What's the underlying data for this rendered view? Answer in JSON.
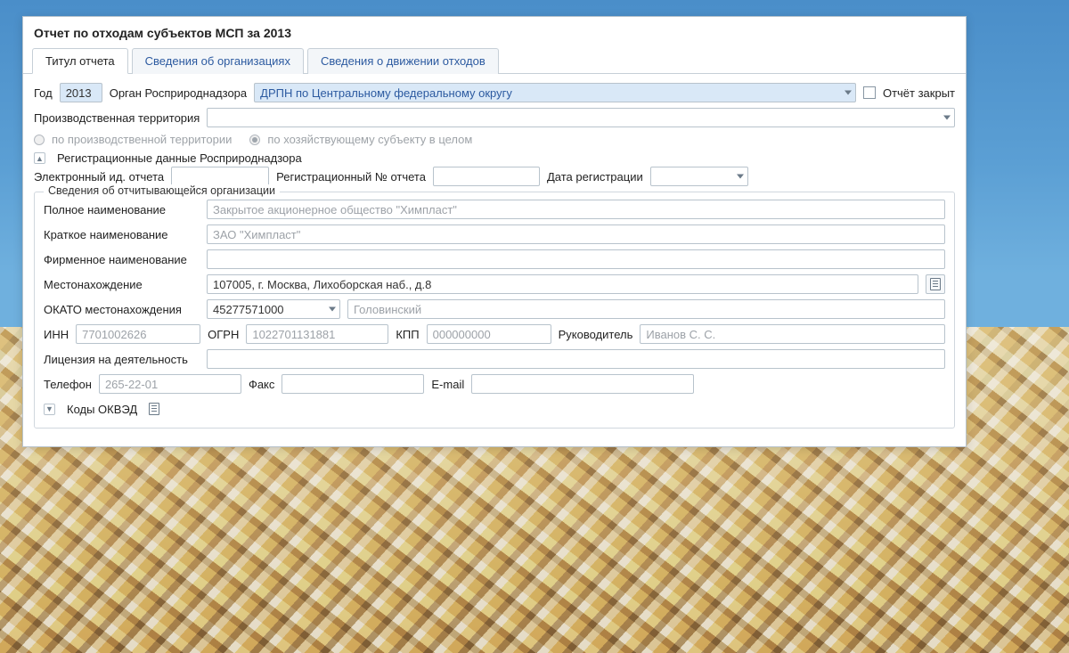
{
  "title": "Отчет по отходам субъектов МСП за 2013",
  "tabs": {
    "t0": "Титул отчета",
    "t1": "Сведения об организациях",
    "t2": "Сведения о движении отходов"
  },
  "top": {
    "yearLabel": "Год",
    "year": "2013",
    "agencyLabel": "Орган Росприроднадзора",
    "agency": "ДРПН по Центральному федеральному округу",
    "closedLabel": "Отчёт закрыт",
    "territoryLabel": "Производственная территория",
    "radio1": "по производственной территории",
    "radio2": "по хозяйствующему субъекту в целом"
  },
  "reg": {
    "header": "Регистрационные данные Росприроднадзора",
    "toggle": "▲",
    "eidLabel": "Электронный ид. отчета",
    "regNoLabel": "Регистрационный № отчета",
    "regDateLabel": "Дата регистрации"
  },
  "org": {
    "header": "Сведения об отчитывающейся организации",
    "fullLabel": "Полное наименование",
    "full": "Закрытое акционерное общество \"Химпласт\"",
    "shortLabel": "Краткое наименование",
    "short": "ЗАО \"Химпласт\"",
    "brandLabel": "Фирменное наименование",
    "locLabel": "Местонахождение",
    "loc": "107005, г. Москва, Лихоборская наб., д.8",
    "okatoLabel": "ОКАТО местонахождения",
    "okato": "45277571000",
    "okatoName": "Головинский",
    "innLabel": "ИНН",
    "inn": "7701002626",
    "ogrnLabel": "ОГРН",
    "ogrn": "1022701131881",
    "kppLabel": "КПП",
    "kpp": "000000000",
    "dirLabel": "Руководитель",
    "dir": "Иванов С. С.",
    "licLabel": "Лицензия на деятельность",
    "phoneLabel": "Телефон",
    "phone": "265-22-01",
    "faxLabel": "Факс",
    "emailLabel": "E-mail",
    "okvedLabel": "Коды ОКВЭД",
    "okvedToggle": "▼"
  }
}
